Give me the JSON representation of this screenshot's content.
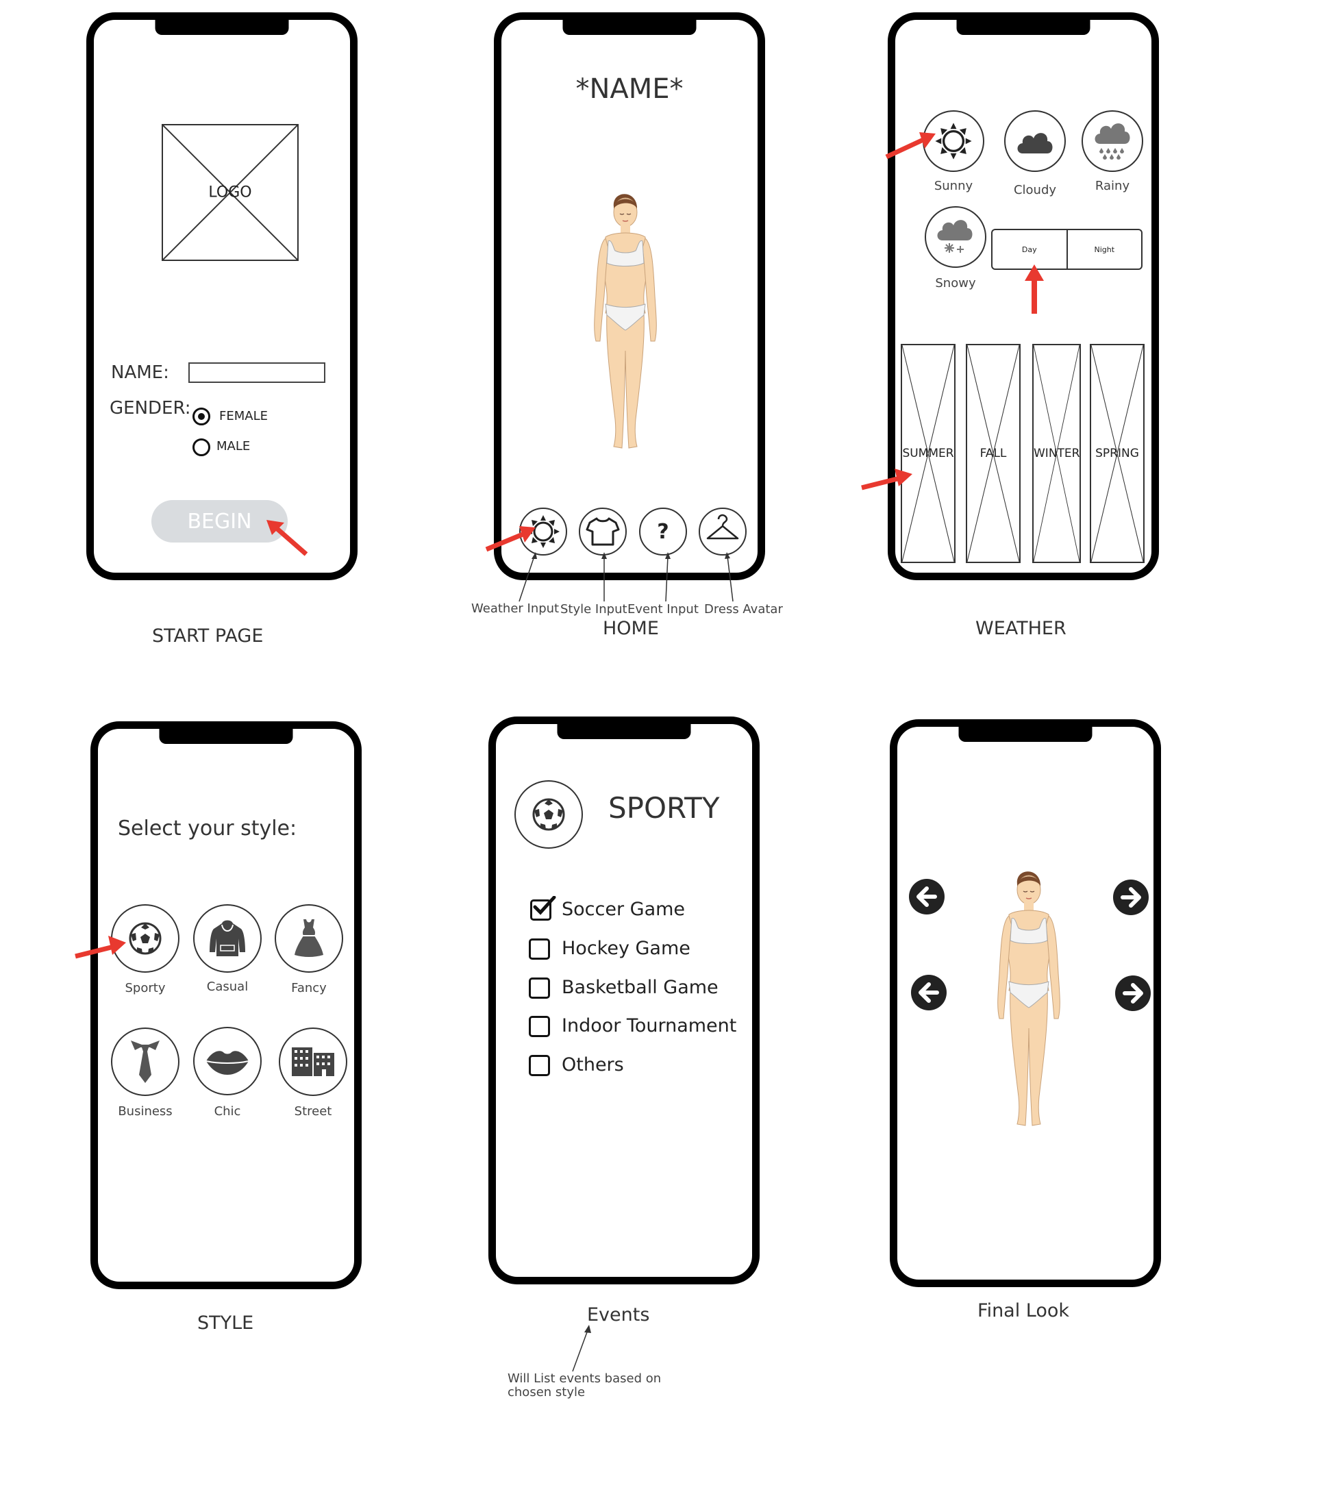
{
  "start": {
    "logo": "LOGO",
    "name_label": "NAME:",
    "name_value": "",
    "gender_label": "GENDER:",
    "female": "FEMALE",
    "male": "MALE",
    "begin": "BEGIN",
    "caption": "START PAGE"
  },
  "home": {
    "title": "*NAME*",
    "ann_weather": "Weather Input",
    "ann_style": "Style Input",
    "ann_event": "Event Input",
    "ann_dress": "Dress Avatar",
    "caption": "HOME"
  },
  "weather": {
    "sunny": "Sunny",
    "cloudy": "Cloudy",
    "rainy": "Rainy",
    "snowy": "Snowy",
    "day": "Day",
    "night": "Night",
    "seasons": [
      "SUMMER",
      "FALL",
      "WINTER",
      "SPRING"
    ],
    "caption": "WEATHER"
  },
  "style": {
    "title": "Select your style:",
    "items": [
      "Sporty",
      "Casual",
      "Fancy",
      "Business",
      "Chic",
      "Street"
    ],
    "caption": "STYLE"
  },
  "events": {
    "title": "SPORTY",
    "items": [
      "Soccer Game",
      "Hockey Game",
      "Basketball Game",
      "Indoor Tournament",
      "Others"
    ],
    "checked": [
      true,
      false,
      false,
      false,
      false
    ],
    "caption": "Events",
    "note_line1": "Will List events based on",
    "note_line2": "chosen style"
  },
  "final": {
    "caption": "Final Look"
  },
  "colors": {
    "arrow": "#e8392f",
    "frame": "#000000",
    "skin": "#f7d6ae",
    "hair": "#7a4a2c"
  }
}
